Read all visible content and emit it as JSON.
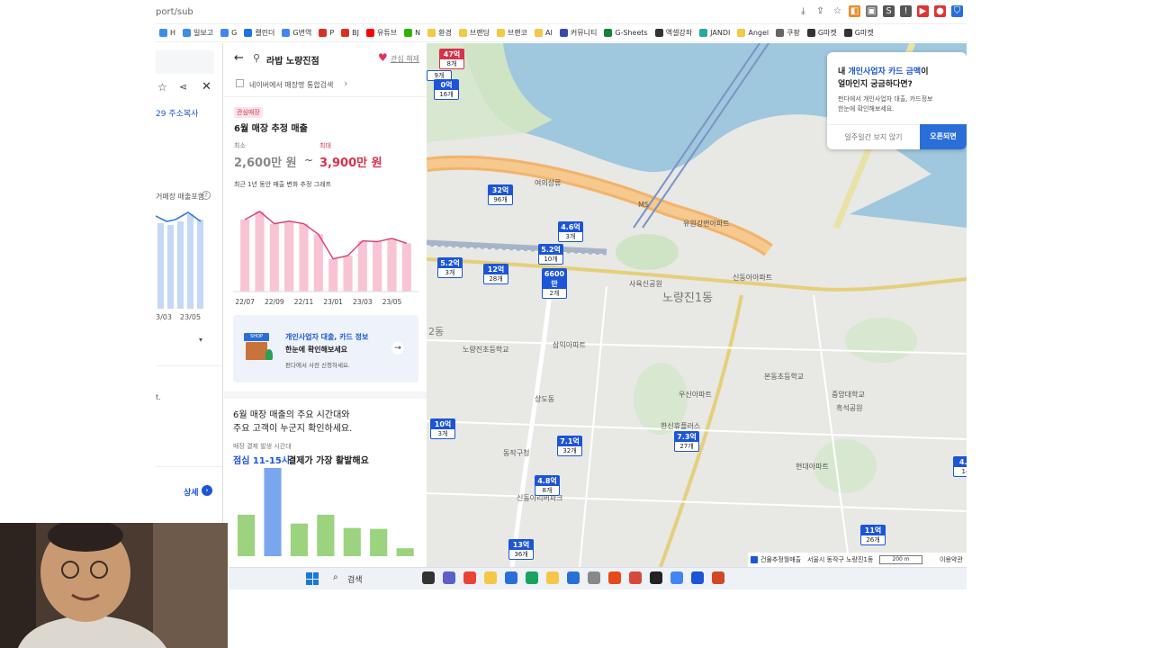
{
  "browser": {
    "url_fragment": "port/sub",
    "bookmarks": [
      "H",
      "일보고",
      "G",
      "캘린더",
      "G번역",
      "P",
      "BJ",
      "유튜브",
      "N",
      "환경",
      "브랜딩",
      "브랜코",
      "AI",
      "커뮤니티",
      "G-Sheets",
      "엑셀강좌",
      "JANDI",
      "Angel",
      "쿠팡",
      "G마켓",
      "G마켓"
    ]
  },
  "left_panel": {
    "address_copy": "29 주소복사",
    "sales_incl": "거매장 매출포함",
    "x_labels": [
      "3/03",
      "23/05"
    ],
    "detail": "상세",
    "misc": "t."
  },
  "store": {
    "name": "라밥 노량진점",
    "interest_label": "관심 해제",
    "naver_link": "네이버에서 매장명 통합검색",
    "badge": "관심매장",
    "estimate_title": "6월 매장 추정 매출",
    "min_label": "최소",
    "max_label": "최대",
    "min_value": "2,600만 원",
    "tilde": "~",
    "max_value": "3,900만 원",
    "graph_caption": "최근 1년 동안 매출 변화 추정 그래프"
  },
  "chart_data": {
    "type": "bar",
    "categories": [
      "22/07",
      "22/08",
      "22/09",
      "22/10",
      "22/11",
      "22/12",
      "23/01",
      "23/02",
      "23/03",
      "23/04",
      "23/05",
      "23/06"
    ],
    "tick_labels": [
      "22/07",
      "22/09",
      "22/11",
      "23/01",
      "23/03",
      "23/05"
    ],
    "values": [
      88,
      98,
      83,
      86,
      83,
      70,
      40,
      44,
      62,
      61,
      65,
      59
    ],
    "ylim": [
      0,
      110
    ],
    "bar_color": "#f8c4d3",
    "line_color": "#d8457a"
  },
  "promo": {
    "icon_label": "SHOP",
    "title_accent": "개인사업자 대출, 카드 정보",
    "title_rest": "한눈에 확인해보세요",
    "sub": "펀다에서 사전 신청하세요."
  },
  "hours": {
    "headline_1": "6월 매장 매출의 주요 시간대와",
    "headline_2": "주요 고객이 누군지 확인하세요.",
    "sub_label": "매장 결제 발생 시간대",
    "peak_accent": "점심 11-15시",
    "peak_rest": "결제가 가장 활발해요"
  },
  "hours_chart": {
    "type": "bar",
    "values": [
      47,
      100,
      37,
      47,
      32,
      31,
      9
    ],
    "highlight_index": 1,
    "bar_color": "#9bd37e",
    "highlight_color": "#7aa6ef"
  },
  "map": {
    "popup": {
      "line1_pre": "내 ",
      "line1_accent": "개인사업자 카드 금액",
      "line1_post": "이",
      "line2": "얼마인지 궁금하다면?",
      "body1": "펀다에서 개인사업자 대출, 카드정보",
      "body2": "한눈에 확인해보세요.",
      "dismiss": "일주일간 보지 않기",
      "open": "오픈되면"
    },
    "markers": [
      {
        "v": "47억",
        "c": "8개",
        "red": true
      },
      {
        "v": "",
        "c": "9개"
      },
      {
        "v": "0억",
        "c": "16개"
      },
      {
        "v": "32억",
        "c": "96개"
      },
      {
        "v": "4.6억",
        "c": "3개"
      },
      {
        "v": "5.2억",
        "c": "10개"
      },
      {
        "v": "5.2억",
        "c": "3개"
      },
      {
        "v": "12억",
        "c": "28개"
      },
      {
        "v": "6600만",
        "c": "2개"
      },
      {
        "v": "10억",
        "c": "3개"
      },
      {
        "v": "7.1억",
        "c": "32개"
      },
      {
        "v": "7.3억",
        "c": "27개"
      },
      {
        "v": "4.8억",
        "c": "8개"
      },
      {
        "v": "13억",
        "c": "36개"
      },
      {
        "v": "11억",
        "c": "26개"
      },
      {
        "v": "4.0",
        "c": "14"
      }
    ],
    "labels": [
      "노량진1동",
      "2동",
      "유원강변아파트",
      "노량진초등학교",
      "상도동",
      "흑석공원",
      "사육신공원",
      "한신휴플러스",
      "동작구청",
      "신동아아파트",
      "본동초등학교",
      "중앙대학교",
      "여의상류",
      "MS",
      "현대아파트",
      "우신아파트",
      "삼익아파트",
      "신동아리버파크"
    ],
    "legend": "건물추정월매출",
    "address": "서울시 동작구 노량진1동",
    "scale": "200 m",
    "terms": "이용약관"
  },
  "taskbar": {
    "search": "검색"
  },
  "colors": {
    "accent_pink": "#d8314a",
    "accent_blue": "#1c55d6",
    "map_road": "#f2b36a",
    "river": "#9fc7dd"
  }
}
